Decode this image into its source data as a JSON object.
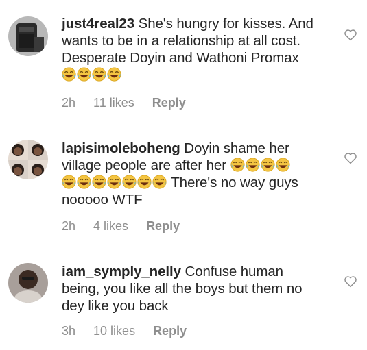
{
  "comments": [
    {
      "username": "just4real23",
      "text_line1": " She's hungry for kisses. And",
      "text_line2": "wants to be in a relationship at all cost.",
      "text_line3": "Desperate Doyin and Wathoni Promax",
      "time": "2h",
      "likes": "11 likes",
      "reply": "Reply",
      "emoji_count": 4
    },
    {
      "username": "lapisimoleboheng",
      "text_line1": " Doyin shame her",
      "text_line2": "village people are after her ",
      "text_line3": " There's no way guys",
      "text_line4": "nooooo WTF",
      "time": "2h",
      "likes": "4 likes",
      "reply": "Reply"
    },
    {
      "username": "iam_symply_nelly",
      "text_line1": " Confuse human",
      "text_line2": "being, you like all the boys but them no",
      "text_line3": "dey like you back",
      "time": "3h",
      "likes": "10 likes",
      "reply": "Reply"
    }
  ],
  "icons": {
    "heart": "heart-outline-icon",
    "emoji": "face-with-tears-of-joy-emoji"
  },
  "colors": {
    "text": "#262626",
    "meta": "#8e8e8e",
    "background": "#ffffff"
  }
}
